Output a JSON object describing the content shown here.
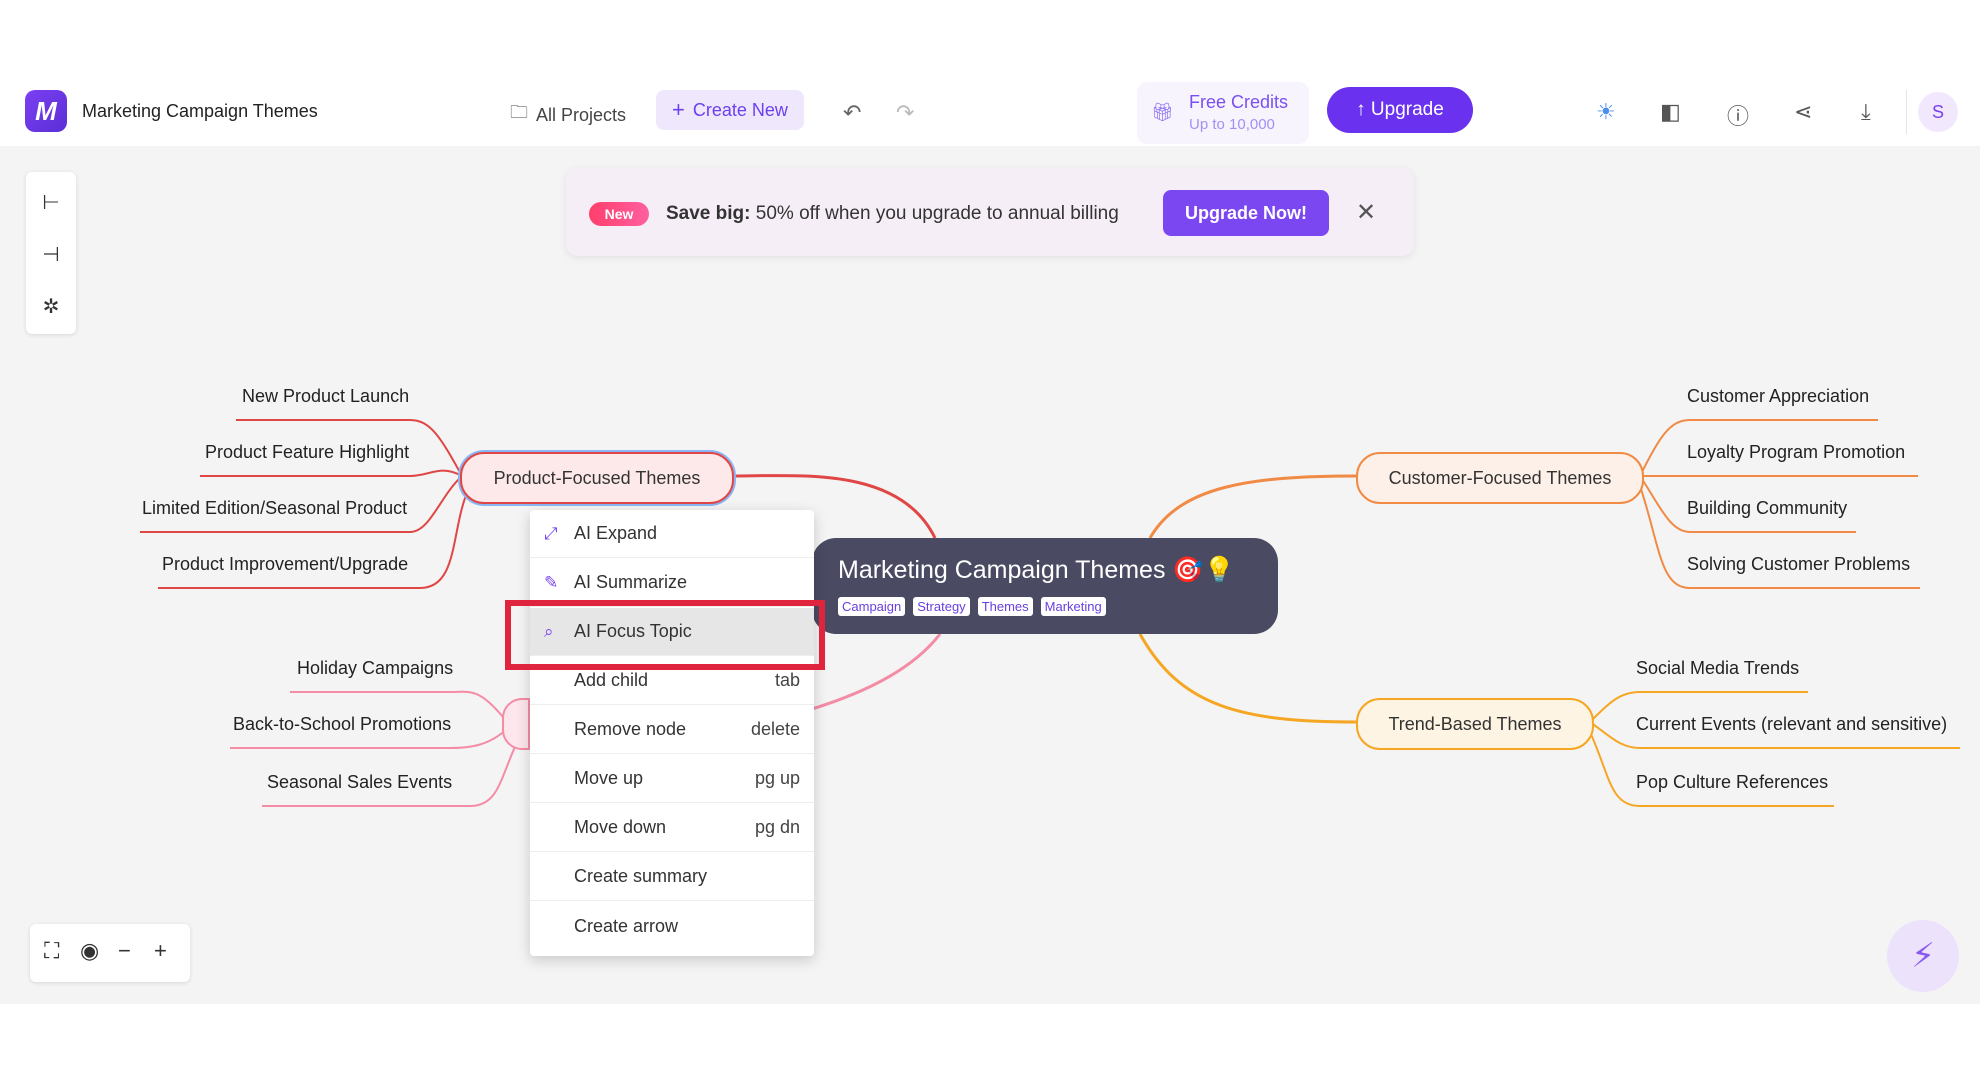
{
  "header": {
    "logo_letter": "M",
    "doc_title": "Marketing Campaign Themes",
    "all_projects": "All Projects",
    "create_new": "Create New",
    "credits_title": "Free Credits",
    "credits_sub": "Up to 10,000",
    "upgrade": "↑ Upgrade",
    "avatar_letter": "S"
  },
  "promo": {
    "badge": "New",
    "bold": "Save big:",
    "text": " 50% off when you upgrade to annual billing",
    "button": "Upgrade Now!"
  },
  "mindmap": {
    "root": {
      "title": "Marketing Campaign Themes 🎯💡",
      "tags": [
        "Campaign",
        "Strategy",
        "Themes",
        "Marketing"
      ]
    },
    "branches": {
      "product": {
        "label": "Product-Focused Themes",
        "color": "#e04646",
        "leaves": [
          "New Product Launch",
          "Product Feature Highlight",
          "Limited Edition/Seasonal Product",
          "Product Improvement/Upgrade"
        ]
      },
      "seasonal": {
        "color": "#f48ca6",
        "leaves": [
          "Holiday Campaigns",
          "Back-to-School Promotions",
          "Seasonal Sales Events"
        ]
      },
      "customer": {
        "label": "Customer-Focused Themes",
        "color": "#f08a45",
        "leaves": [
          "Customer Appreciation",
          "Loyalty Program Promotion",
          "Building Community",
          "Solving Customer Problems"
        ]
      },
      "trend": {
        "label": "Trend-Based Themes",
        "color": "#f5a623",
        "leaves": [
          "Social Media Trends",
          "Current Events (relevant and sensitive)",
          "Pop Culture References"
        ]
      }
    }
  },
  "context_menu": {
    "items": [
      {
        "label": "AI Expand",
        "key": ""
      },
      {
        "label": "AI Summarize",
        "key": ""
      },
      {
        "label": "AI Focus Topic",
        "key": ""
      },
      {
        "label": "Add child",
        "key": "tab"
      },
      {
        "label": "Remove node",
        "key": "delete"
      },
      {
        "label": "Move up",
        "key": "pg up"
      },
      {
        "label": "Move down",
        "key": "pg dn"
      },
      {
        "label": "Create summary",
        "key": ""
      },
      {
        "label": "Create arrow",
        "key": ""
      }
    ]
  },
  "colors": {
    "accent": "#6a32ee",
    "highlight_box": "#e0243d",
    "root_bg": "#4a4a63"
  }
}
